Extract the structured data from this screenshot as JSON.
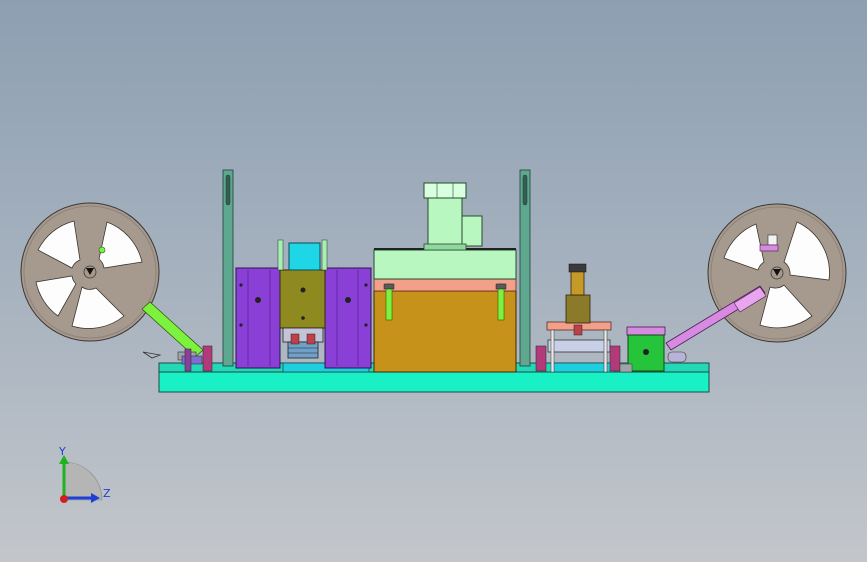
{
  "view": {
    "background_top": "#8d9fb2",
    "background_bottom": "#c3c6cb"
  },
  "triad": {
    "y_label": "Y",
    "z_label": "Z",
    "y_color": "#1fb31f",
    "z_color": "#1f3fd6",
    "x_color": "#d11f1f"
  },
  "parts": {
    "base_plate_color": "#19f0c6",
    "left_reel_color": "#a69a8f",
    "right_reel_color": "#a69a8f",
    "left_arm_color": "#7df23e",
    "right_arm_color": "#d68ae0",
    "purple_block_color": "#8a3fd6",
    "olive_block_color": "#8e8a1f",
    "gold_box_color": "#c7921a",
    "motor_color": "#b8f7c0",
    "pink_strip_color": "#f2a08a",
    "green_box_color": "#25c43a"
  }
}
